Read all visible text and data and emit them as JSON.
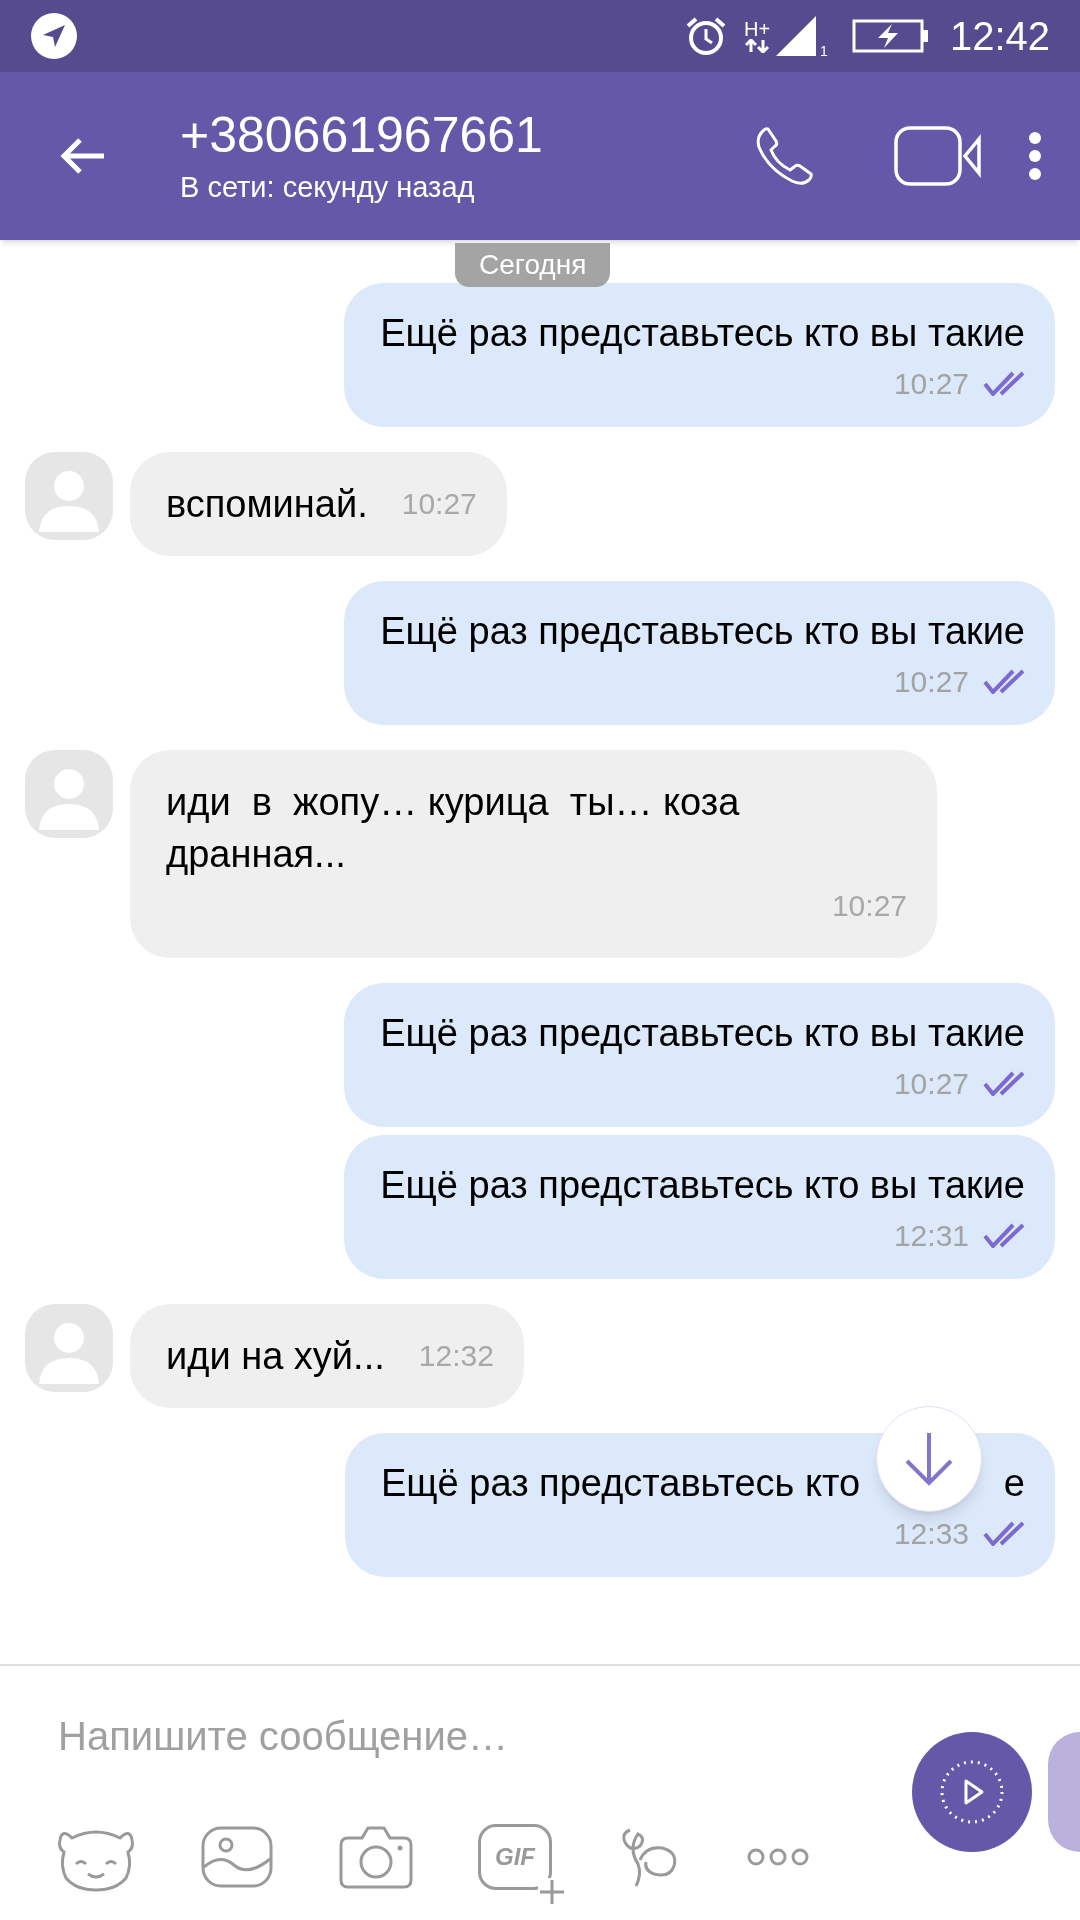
{
  "status_bar": {
    "network_type": "H+",
    "sim": "1",
    "time": "12:42"
  },
  "header": {
    "title": "+380661967661",
    "subtitle": "В сети: секунду назад"
  },
  "date_chip": "Сегодня",
  "messages": [
    {
      "kind": "outgoing",
      "text": "Ещё раз представьтесь кто вы такие",
      "time": "10:27",
      "read": true
    },
    {
      "kind": "incoming",
      "text": "вспоминай.",
      "time": "10:27"
    },
    {
      "kind": "outgoing",
      "text": "Ещё раз представьтесь кто вы такие",
      "time": "10:27",
      "read": true
    },
    {
      "kind": "incoming",
      "text": "иди  в  жопу… курица  ты… коза дранная...",
      "time": "10:27"
    },
    {
      "kind": "outgoing",
      "text": "Ещё раз представьтесь кто вы такие",
      "time": "10:27",
      "read": true
    },
    {
      "kind": "outgoing",
      "text": "Ещё раз представьтесь кто вы такие",
      "time": "12:31",
      "read": true
    },
    {
      "kind": "incoming",
      "text": "иди на хуй...",
      "time": "12:32"
    },
    {
      "kind": "outgoing_covered",
      "text": "Ещё раз представьтесь кто",
      "text_end": "е",
      "time": "12:33",
      "read": true
    }
  ],
  "composer": {
    "placeholder": "Напишите сообщение…",
    "gif_label": "GIF"
  }
}
